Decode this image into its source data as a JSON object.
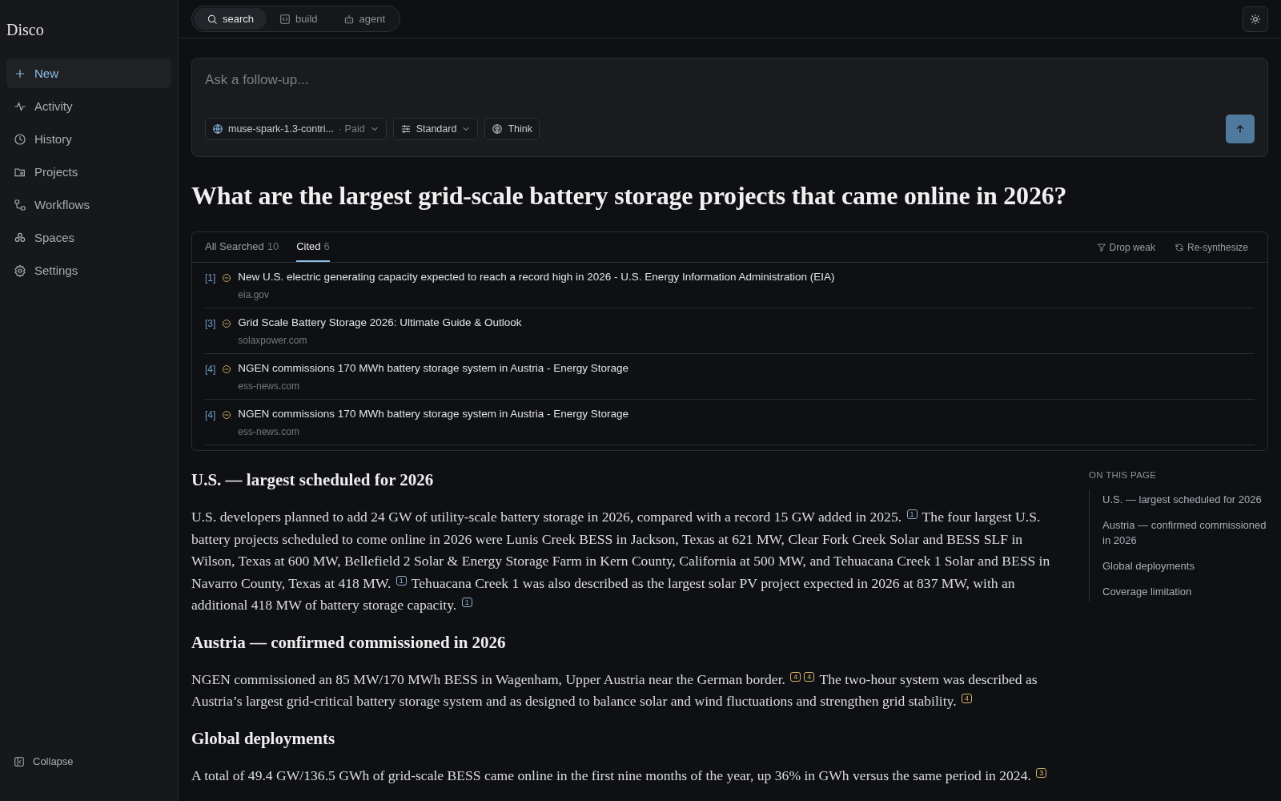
{
  "sidebar": {
    "brand": "Disco",
    "items": [
      {
        "label": "New",
        "selected": true
      },
      {
        "label": "Activity",
        "selected": false
      },
      {
        "label": "History",
        "selected": false
      },
      {
        "label": "Projects",
        "selected": false
      },
      {
        "label": "Workflows",
        "selected": false
      },
      {
        "label": "Spaces",
        "selected": false
      },
      {
        "label": "Settings",
        "selected": false
      }
    ],
    "collapse": "Collapse"
  },
  "modes": [
    {
      "label": "search",
      "selected": true
    },
    {
      "label": "build",
      "selected": false
    },
    {
      "label": "agent",
      "selected": false
    }
  ],
  "composer": {
    "placeholder": "Ask a follow-up...",
    "model": "muse-spark-1.3-contri...",
    "tier": "· Paid",
    "style": "Standard",
    "think": "Think"
  },
  "question": "What are the largest grid-scale battery storage projects that came online in 2026?",
  "sources": {
    "tabs": [
      {
        "label": "All Searched",
        "count": "10",
        "selected": false
      },
      {
        "label": "Cited",
        "count": "6",
        "selected": true
      }
    ],
    "actions": [
      "Drop weak",
      "Re-synthesize"
    ],
    "items": [
      {
        "ref": "[1]",
        "title": "New U.S. electric generating capacity expected to reach a record high in 2026 - U.S. Energy Information Administration (EIA)",
        "domain": "eia.gov"
      },
      {
        "ref": "[3]",
        "title": "Grid Scale Battery Storage 2026: Ultimate Guide & Outlook",
        "domain": "solaxpower.com"
      },
      {
        "ref": "[4]",
        "title": "NGEN commissions 170 MWh battery storage system in Austria - Energy Storage",
        "domain": "ess-news.com"
      },
      {
        "ref": "[4]",
        "title": "NGEN commissions 170 MWh battery storage system in Austria - Energy Storage",
        "domain": "ess-news.com"
      }
    ]
  },
  "sections": [
    {
      "heading": "U.S. — largest scheduled for 2026",
      "paragraph": [
        {
          "text": "U.S. developers planned to add 24 GW of utility-scale battery storage in 2026, compared with a record 15 GW added in 2025. "
        },
        {
          "cite": "1",
          "color": "#8fb0d0"
        },
        {
          "text": " The four largest U.S. battery projects scheduled to come online in 2026 were Lunis Creek BESS in Jackson, Texas at 621 MW, Clear Fork Creek Solar and BESS SLF in Wilson, Texas at 600 MW, Bellefield 2 Solar & Energy Storage Farm in Kern County, California at 500 MW, and Tehuacana Creek 1 Solar and BESS in Navarro County, Texas at 418 MW. "
        },
        {
          "cite": "1",
          "color": "#8fb0d0"
        },
        {
          "text": " Tehuacana Creek 1 was also described as the largest solar PV project expected in 2026 at 837 MW, with an additional 418 MW of battery storage capacity. "
        },
        {
          "cite": "1",
          "color": "#8fb0d0"
        }
      ]
    },
    {
      "heading": "Austria — confirmed commissioned in 2026",
      "paragraph": [
        {
          "text": "NGEN commissioned an 85 MW/170 MWh BESS in Wagenham, Upper Austria near the German border. "
        },
        {
          "cite": "4",
          "color": "#d8b26a"
        },
        {
          "cite": "4",
          "color": "#d8b26a"
        },
        {
          "text": " The two-hour system was described as Austria’s largest grid-critical battery storage system and as designed to balance solar and wind fluctuations and strengthen grid stability. "
        },
        {
          "cite": "4",
          "color": "#d8b26a"
        }
      ]
    },
    {
      "heading": "Global deployments",
      "paragraph": [
        {
          "text": "A total of 49.4 GW/136.5 GWh of grid-scale BESS came online in the first nine months of the year, up 36% in GWh versus the same period in 2024. "
        },
        {
          "cite": "3",
          "color": "#d8b26a"
        }
      ]
    }
  ],
  "toc": {
    "title": "ON THIS PAGE",
    "items": [
      "U.S. — largest scheduled for 2026",
      "Austria — confirmed commissioned in 2026",
      "Global deployments",
      "Coverage limitation"
    ]
  }
}
